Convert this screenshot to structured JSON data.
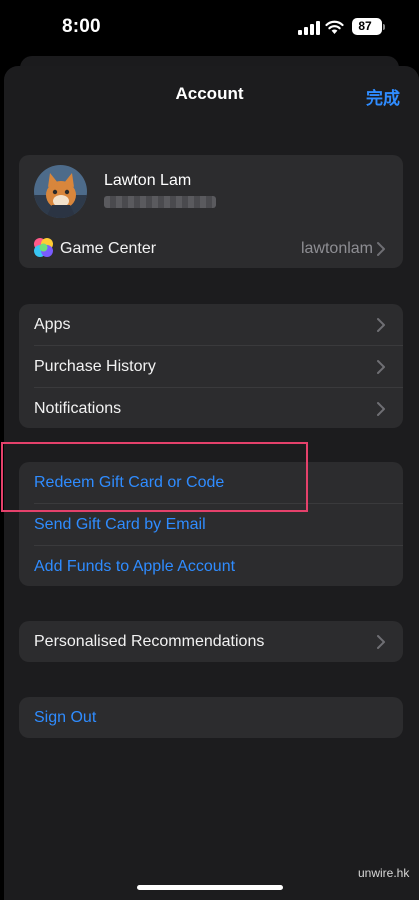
{
  "status_bar": {
    "time": "8:00",
    "battery": "87"
  },
  "nav": {
    "title": "Account",
    "done_label": "完成"
  },
  "profile": {
    "name": "Lawton Lam",
    "game_center_label": "Game Center",
    "game_center_value": "lawtonlam"
  },
  "menu": {
    "apps": "Apps",
    "purchase_history": "Purchase History",
    "notifications": "Notifications"
  },
  "gift": {
    "redeem": "Redeem Gift Card or Code",
    "send": "Send Gift Card by Email",
    "add_funds": "Add Funds to Apple Account"
  },
  "recommendations": {
    "label": "Personalised Recommendations"
  },
  "sign_out": {
    "label": "Sign Out"
  },
  "watermark": "unwire.hk",
  "colors": {
    "accent": "#2f8cff",
    "highlight": "#e5416b",
    "background": "#1c1c1e",
    "group": "#2c2c2e"
  },
  "icons": [
    "signal-icon",
    "wifi-icon",
    "battery-icon",
    "game-center-icon",
    "chevron-right-icon"
  ]
}
